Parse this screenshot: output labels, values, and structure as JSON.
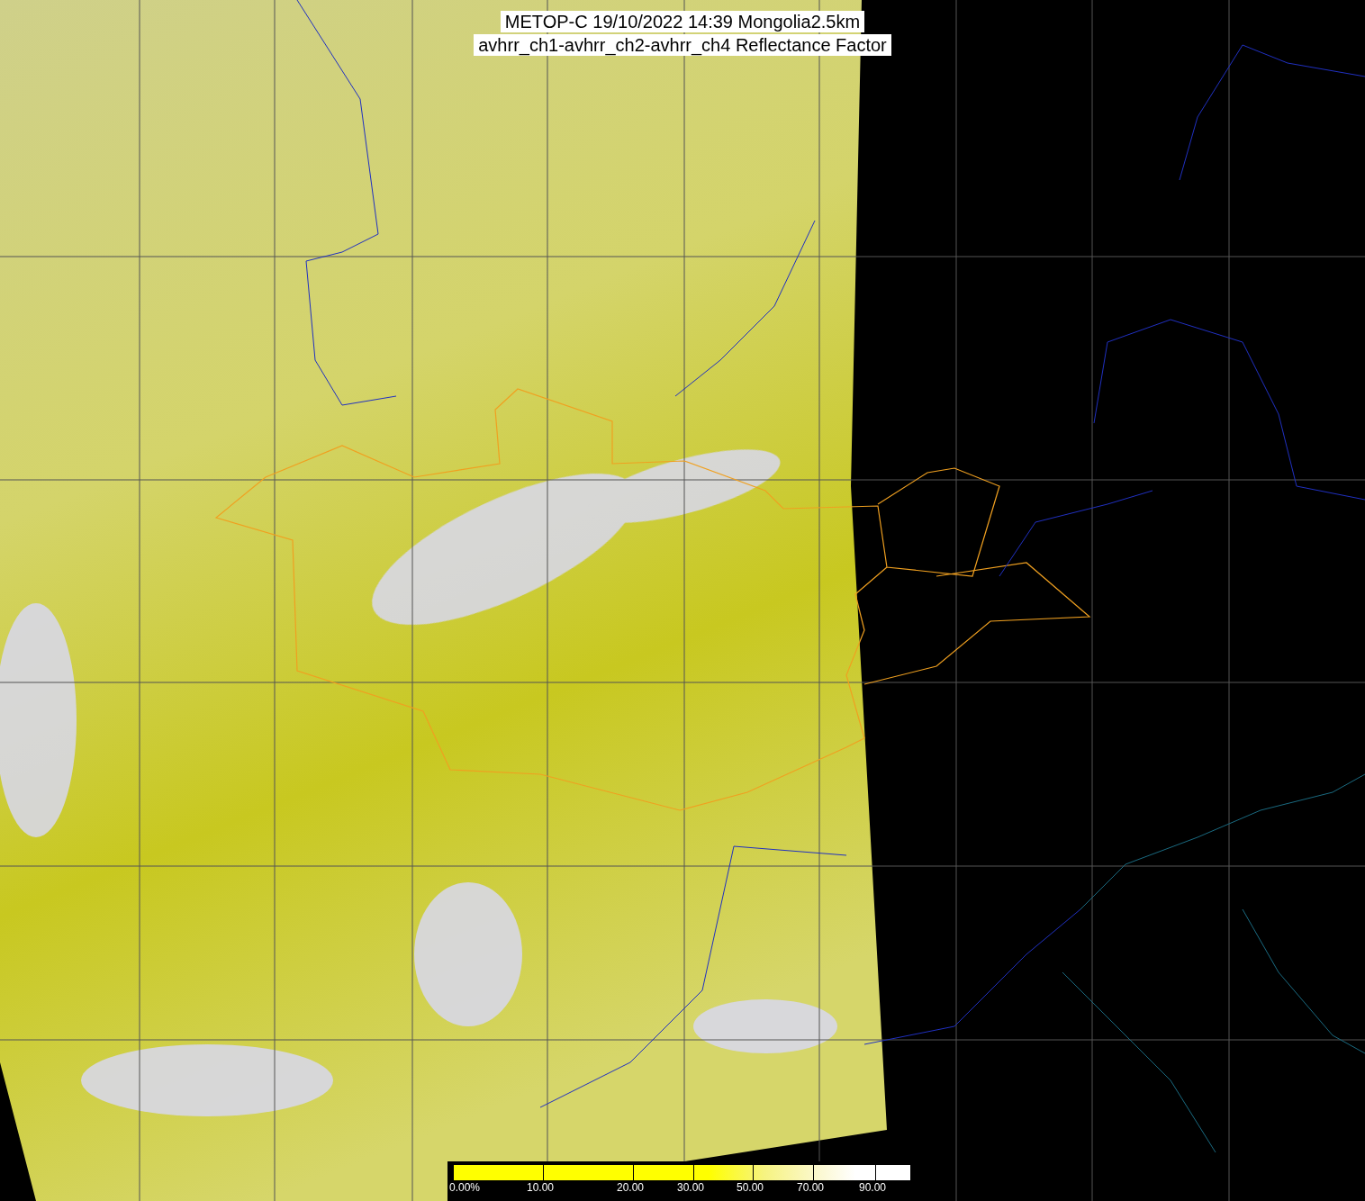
{
  "title": {
    "line_1": "METOP-C 19/10/2022 14:39 Mongolia2.5km",
    "line_2": "avhrr_ch1-avhrr_ch2-avhrr_ch4 Reflectance Factor"
  },
  "color_scale": {
    "ticks": [
      "0.00%",
      "10.00",
      "20.00",
      "30.00",
      "50.00",
      "70.00",
      "90.00"
    ]
  }
}
